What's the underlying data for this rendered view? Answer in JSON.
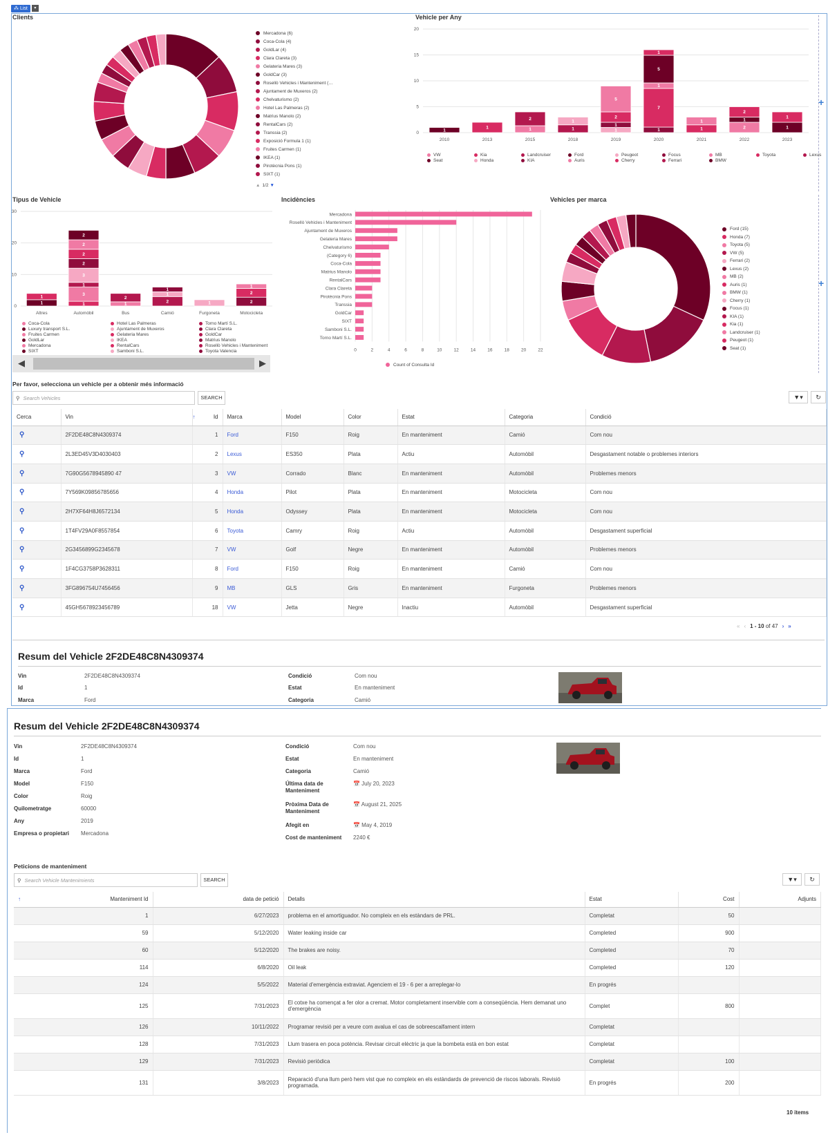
{
  "toolbar": {
    "list_label": "List"
  },
  "dashboard": {
    "clients_title": "Clients",
    "clients_legend": [
      {
        "label": "Mercadona (6)",
        "color": "#6d0026"
      },
      {
        "label": "Coca-Cola (4)",
        "color": "#8f0c3c"
      },
      {
        "label": "GoldLar (4)",
        "color": "#b3184e"
      },
      {
        "label": "Clara Clareta (3)",
        "color": "#d82b62"
      },
      {
        "label": "Gelateria Mares (3)",
        "color": "#f07aa4"
      },
      {
        "label": "GoldCar (3)",
        "color": "#6d0026"
      },
      {
        "label": "Rosellò Vehicles i Manteniment (…",
        "color": "#8f0c3c"
      },
      {
        "label": "Ajuntament de Muxeros (2)",
        "color": "#b3184e"
      },
      {
        "label": "Chelvaturismo (2)",
        "color": "#d82b62"
      },
      {
        "label": "Hotel Las Palmeras (2)",
        "color": "#f07aa4"
      },
      {
        "label": "Matrius Manolo (2)",
        "color": "#6d0026"
      },
      {
        "label": "RentalCars (2)",
        "color": "#8f0c3c"
      },
      {
        "label": "Transsia (2)",
        "color": "#b3184e"
      },
      {
        "label": "Exposició Formula 1 (1)",
        "color": "#d82b62"
      },
      {
        "label": "Fruites Carmen (1)",
        "color": "#f07aa4"
      },
      {
        "label": "IKEA (1)",
        "color": "#6d0026"
      },
      {
        "label": "Pirotècnia Pons (1)",
        "color": "#8f0c3c"
      },
      {
        "label": "SIXT (1)",
        "color": "#b3184e"
      }
    ],
    "clients_pager": "1/2",
    "clients_slices": [
      6,
      4,
      4,
      3,
      3,
      3,
      2,
      2,
      2,
      2,
      2,
      2,
      2,
      1,
      1,
      1,
      1,
      1,
      1,
      1,
      1,
      1
    ],
    "vehicle_year_title": "Vehicle per Any",
    "vehicles_title": "Vehicles per marca",
    "tipus_title": "Tipus de Vehicle",
    "incidencies_title": "Incidències",
    "incidencies_axis_label": "Count of Consulta Id",
    "vehicle_year_legend": [
      "VW",
      "Kia",
      "Landcruiser",
      "Ford",
      "Peugeot",
      "Focus",
      "MB",
      "Toyota",
      "Lexus",
      "Seat",
      "Honda",
      "KIA",
      "Auris",
      "Cherry",
      "Ferrari",
      "BMW"
    ],
    "tipus_legend": [
      "Coca-Cola",
      "Hotel Las Palmeras",
      "Torno Martí S.L.",
      "Luxury transport S.L.",
      "Ajuntament de Muxeros",
      "Clara Clareta",
      "Fruites Carmen",
      "Gelateria Mares",
      "GoldCar",
      "GoldLar",
      "IKEA",
      "Matrius Manolo",
      "Mercadona",
      "RentalCars",
      "Rosellò Vehicles i Manteniment",
      "SIXT",
      "Samboni S.L.",
      "Toyota Valencia"
    ],
    "marca_legend": [
      "Ford (15)",
      "Honda (7)",
      "Toyota (5)",
      "VW (5)",
      "Ferrari (2)",
      "Lexus (2)",
      "MB (2)",
      "Auris (1)",
      "BMW (1)",
      "Cherry (1)",
      "Focus (1)",
      "KIA (1)",
      "Kia (1)",
      "Landcruiser (1)",
      "Peugeot (1)",
      "Seat (1)"
    ]
  },
  "chart_data": [
    {
      "type": "pie",
      "title": "Clients",
      "categories": [
        "Mercadona",
        "Coca-Cola",
        "GoldLar",
        "Clara Clareta",
        "Gelateria Mares",
        "GoldCar",
        "Rosellò Vehicles i Manteniment",
        "Ajuntament de Muxeros",
        "Chelvaturismo",
        "Hotel Las Palmeras",
        "Matrius Manolo",
        "RentalCars",
        "Transsia",
        "Exposició Formula 1",
        "Fruites Carmen",
        "IKEA",
        "Pirotècnia Pons",
        "SIXT"
      ],
      "values": [
        6,
        4,
        4,
        3,
        3,
        3,
        2,
        2,
        2,
        2,
        2,
        2,
        2,
        1,
        1,
        1,
        1,
        1
      ]
    },
    {
      "type": "bar",
      "title": "Vehicle per Any",
      "categories": [
        "2010",
        "2013",
        "2015",
        "2018",
        "2019",
        "2020",
        "2021",
        "2022",
        "2023"
      ],
      "values": [
        1,
        2,
        4,
        3,
        9,
        16,
        3,
        5,
        4
      ],
      "ylim": [
        0,
        20
      ],
      "yticks": [
        0,
        5,
        10,
        15,
        20
      ],
      "segment_labels": [
        [
          1
        ],
        [
          1
        ],
        [
          1,
          2
        ],
        [
          1,
          1
        ],
        [
          1,
          1,
          2,
          5
        ],
        [
          1,
          7,
          1,
          5,
          1
        ],
        [
          1,
          1
        ],
        [
          2,
          1,
          2
        ],
        [
          1,
          1
        ]
      ]
    },
    {
      "type": "bar",
      "title": "Tipus de Vehicle",
      "categories": [
        "Altres",
        "Automòbil",
        "Bus",
        "Camió",
        "Furgoneta",
        "Motocicleta"
      ],
      "values": [
        4,
        24,
        4,
        6,
        2,
        7
      ],
      "ylim": [
        0,
        30
      ],
      "yticks": [
        0,
        10,
        20,
        30
      ],
      "segment_labels": [
        [
          1,
          1
        ],
        [
          1,
          3,
          1,
          3,
          2,
          2,
          2,
          2
        ],
        [
          1,
          2
        ],
        [
          2,
          1,
          1
        ],
        [
          1
        ],
        [
          2,
          2,
          1
        ]
      ]
    },
    {
      "type": "bar",
      "title": "Incidències",
      "orientation": "horizontal",
      "categories": [
        "Mercadona",
        "Rosellò Vehicles i Manteniment",
        "Ajuntament de Muxeros",
        "Gelateria Mares",
        "Chelvaturismo",
        "(Category 6)",
        "Coca-Cola",
        "Matrius Manolo",
        "RentalCars",
        "Clara Clareta",
        "Pirotècnia Pons",
        "Transsia",
        "GoldCar",
        "SIXT",
        "Samboni S.L.",
        "Torno Martí S.L."
      ],
      "values": [
        21,
        12,
        5,
        5,
        4,
        3,
        3,
        3,
        3,
        2,
        2,
        2,
        1,
        1,
        1,
        1
      ],
      "xlim": [
        0,
        22
      ],
      "xticks": [
        0,
        2,
        4,
        6,
        8,
        10,
        12,
        14,
        16,
        18,
        20,
        22
      ],
      "xlabel": "Count of Consulta Id"
    },
    {
      "type": "pie",
      "title": "Vehicles per marca",
      "categories": [
        "Ford",
        "Honda",
        "Toyota",
        "VW",
        "Ferrari",
        "Lexus",
        "MB",
        "Auris",
        "BMW",
        "Cherry",
        "Focus",
        "KIA",
        "Kia",
        "Landcruiser",
        "Peugeot",
        "Seat"
      ],
      "values": [
        15,
        7,
        5,
        5,
        2,
        2,
        2,
        1,
        1,
        1,
        1,
        1,
        1,
        1,
        1,
        1
      ]
    }
  ],
  "vehicles": {
    "prompt": "Per favor, selecciona un vehicle per a obtenir més informació",
    "search_placeholder": "Search Vehicles",
    "search_label": "SEARCH",
    "columns": [
      "Cerca",
      "Vin",
      "Id",
      "Marca",
      "Model",
      "Color",
      "Estat",
      "Categoria",
      "Condició"
    ],
    "rows": [
      {
        "vin": "2F2DE48C8N4309374",
        "id": "1",
        "marca": "Ford",
        "model": "F150",
        "color": "Roig",
        "estat": "En manteniment",
        "categoria": "Camió",
        "condicio": "Com nou"
      },
      {
        "vin": "2L3ED45V3D4030403",
        "id": "2",
        "marca": "Lexus",
        "model": "ES350",
        "color": "Plata",
        "estat": "Actiu",
        "categoria": "Automòbil",
        "condicio": "Desgastament notable o problemes interiors"
      },
      {
        "vin": "7G90G5678945890 47",
        "id": "3",
        "marca": "VW",
        "model": "Corrado",
        "color": "Blanc",
        "estat": "En manteniment",
        "categoria": "Automòbil",
        "condicio": "Problemes menors"
      },
      {
        "vin": "7Y569K09856785656",
        "id": "4",
        "marca": "Honda",
        "model": "Pilot",
        "color": "Plata",
        "estat": "En manteniment",
        "categoria": "Motocicleta",
        "condicio": "Com nou"
      },
      {
        "vin": "2H7XF64H8J6572134",
        "id": "5",
        "marca": "Honda",
        "model": "Odyssey",
        "color": "Plata",
        "estat": "En manteniment",
        "categoria": "Motocicleta",
        "condicio": "Com nou"
      },
      {
        "vin": "1T4FV29A0F8557854",
        "id": "6",
        "marca": "Toyota",
        "model": "Camry",
        "color": "Roig",
        "estat": "Actiu",
        "categoria": "Automòbil",
        "condicio": "Desgastament superficial"
      },
      {
        "vin": "2G3456899G2345678",
        "id": "7",
        "marca": "VW",
        "model": "Golf",
        "color": "Negre",
        "estat": "En manteniment",
        "categoria": "Automòbil",
        "condicio": "Problemes menors"
      },
      {
        "vin": "1F4CG3758P3628311",
        "id": "8",
        "marca": "Ford",
        "model": "F150",
        "color": "Roig",
        "estat": "En manteniment",
        "categoria": "Camió",
        "condicio": "Com nou"
      },
      {
        "vin": "3FG896754U7456456",
        "id": "9",
        "marca": "MB",
        "model": "GLS",
        "color": "Gris",
        "estat": "En manteniment",
        "categoria": "Furgoneta",
        "condicio": "Problemes menors"
      },
      {
        "vin": "45GH5678923456789",
        "id": "18",
        "marca": "VW",
        "model": "Jetta",
        "color": "Negre",
        "estat": "Inactiu",
        "categoria": "Automòbil",
        "condicio": "Desgastament superficial"
      }
    ],
    "pager_range": "1 - 10",
    "pager_total": "of 47"
  },
  "summary_small": {
    "title": "Resum del Vehicle 2F2DE48C8N4309374",
    "vin_label": "Vin",
    "vin": "2F2DE48C8N4309374",
    "id_label": "Id",
    "id": "1",
    "marca_label": "Marca",
    "marca": "Ford",
    "condicio_label": "Condició",
    "condicio": "Com nou",
    "estat_label": "Estat",
    "estat": "En manteniment",
    "categoria_label": "Categoria",
    "categoria": "Camió"
  },
  "summary": {
    "title": "Resum del Vehicle 2F2DE48C8N4309374",
    "left": [
      {
        "label": "Vin",
        "value": "2F2DE48C8N4309374"
      },
      {
        "label": "Id",
        "value": "1"
      },
      {
        "label": "Marca",
        "value": "Ford"
      },
      {
        "label": "Model",
        "value": "F150"
      },
      {
        "label": "Color",
        "value": "Roig"
      },
      {
        "label": "Quilometratge",
        "value": "60000"
      },
      {
        "label": "Any",
        "value": "2019"
      },
      {
        "label": "Empresa o propietari",
        "value": "Mercadona"
      }
    ],
    "right": [
      {
        "label": "Condició",
        "value": "Com nou"
      },
      {
        "label": "Estat",
        "value": "En manteniment"
      },
      {
        "label": "Categoria",
        "value": "Camió"
      },
      {
        "label": "Última data de Manteniment",
        "value": "July 20, 2023"
      },
      {
        "label": "Pròxima Data de Manteniment",
        "value": "August 21, 2025"
      },
      {
        "label": "Afegit en",
        "value": "May 4, 2019"
      },
      {
        "label": "Cost de manteniment",
        "value": "2240 €"
      }
    ]
  },
  "maintenance": {
    "title": "Peticions de manteniment",
    "search_placeholder": "Search Vehicle Mantenimients",
    "search_label": "SEARCH",
    "columns": [
      "Manteniment Id",
      "data de petició",
      "Detalls",
      "Estat",
      "Cost",
      "Adjunts"
    ],
    "rows": [
      {
        "id": "1",
        "date": "6/27/2023",
        "details": "problema en el amortiguador. No compleix en els estàndars de PRL.",
        "estat": "Completat",
        "cost": "50"
      },
      {
        "id": "59",
        "date": "5/12/2020",
        "details": "Water leaking inside car",
        "estat": "Completed",
        "cost": "900"
      },
      {
        "id": "60",
        "date": "5/12/2020",
        "details": "The brakes are noisy.",
        "estat": "Completed",
        "cost": "70"
      },
      {
        "id": "114",
        "date": "6/8/2020",
        "details": "Oil leak",
        "estat": "Completed",
        "cost": "120"
      },
      {
        "id": "124",
        "date": "5/5/2022",
        "details": "Material d'emergència extraviat. Agenciem el 19 - 6 per a arreplegar-lo",
        "estat": "En progrés",
        "cost": ""
      },
      {
        "id": "125",
        "date": "7/31/2023",
        "details": "El cotxe ha començat a fer olor a cremat. Motor completament inservible com a conseqüència. Hem demanat uno d'emergència",
        "estat": "Complet",
        "cost": "800"
      },
      {
        "id": "126",
        "date": "10/11/2022",
        "details": "Programar revisió per a veure com avalua el cas de sobreescalfament intern",
        "estat": "Completat",
        "cost": ""
      },
      {
        "id": "128",
        "date": "7/31/2023",
        "details": "Llum trasera en poca potència. Revisar circuit elèctric ja que la bombeta està en bon estat",
        "estat": "Completat",
        "cost": ""
      },
      {
        "id": "129",
        "date": "7/31/2023",
        "details": "Revisió periòdica",
        "estat": "Completat",
        "cost": "100"
      },
      {
        "id": "131",
        "date": "3/8/2023",
        "details": "Reparació d'una llum però hem vist que no compleix en els estàndards de prevenció de riscos laborals. Revisió programada.",
        "estat": "En progrés",
        "cost": "200"
      }
    ],
    "items_count": "10 items"
  },
  "colors": {
    "dark": "#6d0026",
    "mid": "#b3184e",
    "bright": "#d82b62",
    "light": "#f07aa4",
    "pale": "#f6a8c3",
    "bar": "#f0649a",
    "accent": "#3b5bd6"
  }
}
